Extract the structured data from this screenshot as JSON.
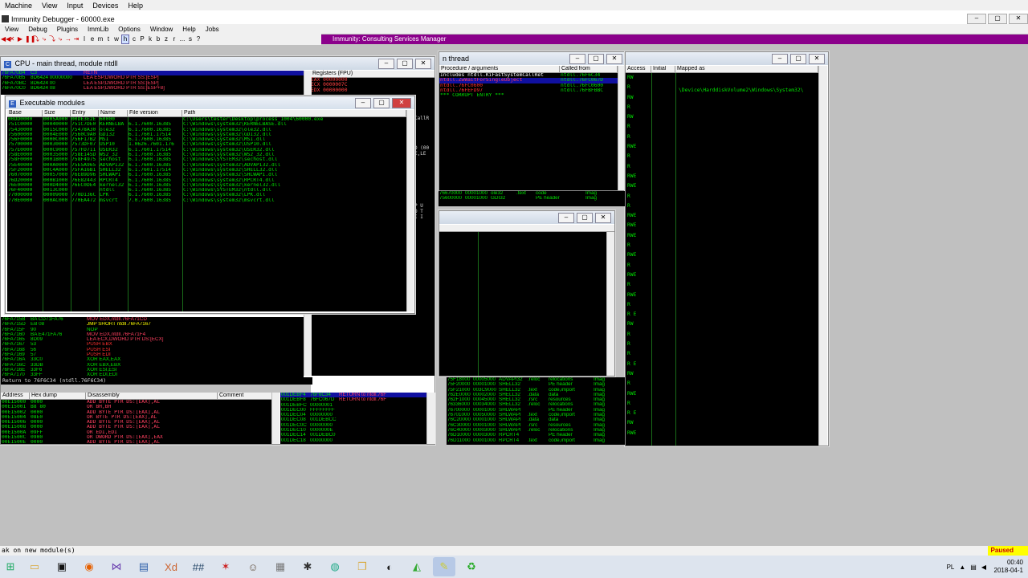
{
  "outer_menu": [
    "Machine",
    "View",
    "Input",
    "Devices",
    "Help"
  ],
  "title": "Immunity Debugger - 60000.exe",
  "app_menu": [
    "View",
    "Debug",
    "Plugins",
    "ImmLib",
    "Options",
    "Window",
    "Help",
    "Jobs"
  ],
  "toolbar_letters": [
    "l",
    "e",
    "m",
    "t",
    "w",
    "h",
    "c",
    "P",
    "k",
    "b",
    "z",
    "r",
    "...",
    "s",
    "?"
  ],
  "banner": "Immunity: Consulting Services Manager",
  "cpu": {
    "title": "CPU - main thread, module ntdll",
    "registers_header": "Registers (FPU)",
    "reg_lines": [
      "EAX 00000000",
      "ECX 0000007C",
      "EDX 00000000"
    ],
    "top_rows": [
      [
        "76FA70B4",
        "C3",
        "RETN"
      ],
      [
        "76FA70B5",
        "8D6424 00000000",
        "LEA ESP,DWORD PTR SS:[ESP]"
      ],
      [
        "76FA70BC",
        "8D6424 00",
        "LEA ESP,DWORD PTR SS:[ESP]"
      ],
      [
        "76FA70C0",
        "8D6424 08",
        "LEA ESP,DWORD PTR SS:[ESP+8]"
      ]
    ],
    "lower_rows": [
      [
        "76FA715B",
        "BA CD71FA76",
        "MOV EDX,ntdll.76FA71CD"
      ],
      [
        "76FA715D",
        "EB 08",
        "JMP SHORT ntdll.76FA7167"
      ],
      [
        "76FA715F",
        "90",
        "NOP"
      ],
      [
        "76FA7160",
        "BA E471FA76",
        "MOV EDX,ntdll.76FA71F4"
      ],
      [
        "76FA7165",
        "8D09",
        "LEA ECX,DWORD PTR DS:[ECX]"
      ],
      [
        "76FA7167",
        "53",
        "PUSH EBX"
      ],
      [
        "76FA7168",
        "56",
        "PUSH ESI"
      ],
      [
        "76FA7169",
        "57",
        "PUSH EDI"
      ],
      [
        "76FA716A",
        "33C0",
        "XOR EAX,EAX"
      ],
      [
        "76FA716C",
        "33DB",
        "XOR EBX,EBX"
      ],
      [
        "76FA716E",
        "33F6",
        "XOR ESI,ESI"
      ],
      [
        "76FA7170",
        "33FF",
        "XOR EDI,EDI"
      ]
    ],
    "return_line": "Return to 76F6C34 (ntdll.76F6C34)",
    "dump_headers": [
      "Address",
      "Hex dump",
      "Disassembly",
      "Comment"
    ],
    "dump_rows": [
      [
        "00E15000",
        "0000",
        "ADD BYTE PTR DS:[EAX],AL"
      ],
      [
        "00E15001",
        "B8 80",
        "OR BH,BH"
      ],
      [
        "00E15002",
        "0000",
        "ADD BYTE PTR DS:[EAX],AL"
      ],
      [
        "00E15004",
        "08E0",
        "OR BYTE PTR DS:[EAX],AL"
      ],
      [
        "00E15006",
        "0000",
        "ADD BYTE PTR DS:[EAX],AL"
      ],
      [
        "00E15008",
        "0000",
        "ADD BYTE PTR DS:[EAX],AL"
      ],
      [
        "00E1500A",
        "09FF",
        "OR EDI,EDI"
      ],
      [
        "00E1500C",
        "0900",
        "OR DWORD PTR DS:[EAX],EAX"
      ],
      [
        "00E1500E",
        "0000",
        "ADD BYTE PTR DS:[EAX],AL"
      ],
      [
        "00E15010",
        "09FF",
        "OR EDI,EDI"
      ]
    ],
    "stack_rows": [
      [
        "001DEBF4",
        "76F6C34",
        "RETURN to ntdll.76F"
      ],
      [
        "001DEBF8",
        "76FC067D",
        "RETURN to ntdll.76F"
      ],
      [
        "001DEBFC",
        "00000001",
        ""
      ],
      [
        "001DEC00",
        "FFFFFFFF",
        ""
      ],
      [
        "001DEC04",
        "00000000",
        ""
      ],
      [
        "001DEC08",
        "001DEBCC",
        ""
      ],
      [
        "001DEC0C",
        "00000000",
        ""
      ],
      [
        "001DEC10",
        "0000000E",
        ""
      ],
      [
        "001DEC14",
        "001DEBC0",
        ""
      ],
      [
        "001DEC18",
        "00000000",
        ""
      ]
    ]
  },
  "modules": {
    "title": "Executable modules",
    "headers": [
      "Base",
      "Size",
      "Entry",
      "Name",
      "File version",
      "Path"
    ],
    "rows": [
      [
        "00DD0000",
        "0005A000",
        "00DE3E2E",
        "60000",
        "",
        "C:\\Users\\tester\\Desktop\\process_1004\\60000.exe"
      ],
      [
        "751C0000",
        "00040000",
        "751C7DE0",
        "KERNELBA",
        "6.1.7600.16385",
        "C:\\Windows\\system32\\KERNELBASE.dll"
      ],
      [
        "75430000",
        "0015C000",
        "75478A30",
        "ole32",
        "6.1.7600.16385",
        "C:\\Windows\\system32\\ole32.dll"
      ],
      [
        "75600000",
        "0004E000",
        "7560C9A0",
        "GDI32",
        "6.1.7601.17514",
        "C:\\Windows\\system32\\GDI32.dll"
      ],
      [
        "756F0000",
        "0000C000",
        "756F17B2",
        "MSI",
        "6.1.7600.16385",
        "C:\\Windows\\system32\\MSI.dll"
      ],
      [
        "75700000",
        "00030000",
        "7573DF07",
        "USP10",
        "1.0626.7601.176",
        "C:\\Windows\\system32\\USP10.dll"
      ],
      [
        "757E0000",
        "000C9000",
        "757FD711",
        "USER32",
        "6.1.7601.17514",
        "C:\\Windows\\system32\\USER32.dll"
      ],
      [
        "758E0000",
        "00035000",
        "758E145D",
        "WS2_32",
        "6.1.7600.16385",
        "C:\\Windows\\system32\\WS2_32.dll"
      ],
      [
        "758F0000",
        "0001B000",
        "758F4975",
        "sechost",
        "6.1.7600.16385",
        "C:\\Windows\\SYSTEM32\\sechost.dll"
      ],
      [
        "75E40000",
        "000A0000",
        "75E5A965",
        "ADVAPI32",
        "6.1.7600.16385",
        "C:\\Windows\\system32\\ADVAPI32.dll"
      ],
      [
        "75F20000",
        "00C4A000",
        "75FA16B1",
        "SHELL32",
        "6.1.7601.17514",
        "C:\\Windows\\system32\\SHELL32.dll"
      ],
      [
        "76070000",
        "00057000",
        "76E89D96",
        "SHLWAPI",
        "6.1.7600.16385",
        "C:\\Windows\\system32\\SHLWAPI.dll"
      ],
      [
        "76D20000",
        "000B1000",
        "76E82443",
        "RPCRT4",
        "6.1.7600.16385",
        "C:\\Windows\\system32\\RPCRT4.dll"
      ],
      [
        "76E00000",
        "000D4000",
        "76EC0DE4",
        "kernel32",
        "6.1.7600.16385",
        "C:\\Windows\\system32\\kernel32.dll"
      ],
      [
        "76F40000",
        "0013C000",
        "",
        "ntdll",
        "6.1.7600.16385",
        "C:\\Windows\\SYSTEM32\\ntdll.dll"
      ],
      [
        "77000000",
        "00009000",
        "770D136C",
        "LPK",
        "6.1.7600.16385",
        "C:\\Windows\\system32\\LPK.dll"
      ],
      [
        "770E0000",
        "000AC000",
        "770EA472",
        "msvcrt",
        "7.0.7600.16385",
        "C:\\Windows\\system32\\msvcrt.dll"
      ]
    ]
  },
  "threads": {
    "title": "n thread",
    "headers": [
      "Procedure / arguments",
      "Called from"
    ],
    "rows": [
      [
        "Includes ntdll.KiFastSystemCallRet",
        "ntdll.76F6C34"
      ],
      [
        "ntdll.ZwWaitForSingleObject",
        "ntdll.76FC067D"
      ],
      [
        "ntdll.76FC0600",
        "ntdll.76FC0600"
      ],
      [
        "ntdll.76FEFD97",
        "ntdll.76FBFBBC"
      ],
      [
        "*** CORRUPT ENTRY ***",
        ""
      ]
    ]
  },
  "memory": {
    "headers": [
      "Access",
      "Initial",
      "Mapped as"
    ],
    "mapped": "\\Device\\HarddiskVolume2\\Windows\\System32\\",
    "mid_rows": [
      [
        "76670000",
        "00001000",
        "ole32",
        ".text",
        "code",
        "Imag"
      ],
      [
        "75600000",
        "00001000",
        "GDI32",
        "",
        "PE header",
        "Imag"
      ]
    ],
    "bottom_rows": [
      [
        "75F18000",
        "00005000",
        "ADVAPI32",
        ".reloc",
        "relocations",
        "Imag"
      ],
      [
        "75F20000",
        "00001000",
        "SHELL32",
        "",
        "PE header",
        "Imag"
      ],
      [
        "75F21000",
        "003C9000",
        "SHELL32",
        ".text",
        "code,import",
        "Imag"
      ],
      [
        "762E0000",
        "00002000",
        "SHELL32",
        ".data",
        "data",
        "Imag"
      ],
      [
        "762F1000",
        "00045000",
        "SHELL32",
        ".rsrc",
        "resources",
        "Imag"
      ],
      [
        "76336000",
        "00034000",
        "SHELL32",
        ".reloc",
        "relocations",
        "Imag"
      ],
      [
        "76700000",
        "00001000",
        "SHLWAPI",
        "",
        "PE header",
        "Imag"
      ],
      [
        "76701000",
        "00050000",
        "SHLWAPI",
        ".text",
        "code,import",
        "Imag"
      ],
      [
        "76C20000",
        "00001000",
        "SHLWAPI",
        ".data",
        "data",
        "Imag"
      ],
      [
        "76C30000",
        "00001000",
        "SHLWAPI",
        ".rsrc",
        "resources",
        "Imag"
      ],
      [
        "76C40000",
        "00003000",
        "SHLWAPI",
        ".reloc",
        "relocations",
        "Imag"
      ],
      [
        "76D10000",
        "00003000",
        "RPCRT4",
        "",
        "PE header",
        "Imag"
      ],
      [
        "76D11000",
        "00001000",
        "RPCRT4",
        ".text",
        "code,import",
        "Imag"
      ]
    ],
    "access_vals": [
      "RW",
      "R",
      "RW",
      "R",
      "RW",
      "R",
      "R",
      "RWE",
      "R",
      "R",
      "RWE",
      "RWE",
      "R",
      "R",
      "RWE",
      "RWE",
      "RWE",
      "R",
      "RWE",
      "R",
      "RWE",
      "R",
      "RWE",
      "R",
      "R E",
      "RW",
      "R",
      "R",
      "R",
      "R E",
      "RW",
      "R",
      "RWE",
      "R",
      "R E",
      "RW",
      "RWE"
    ]
  },
  "status": "ak on new module(s)",
  "paused": "Paused",
  "clock": {
    "time": "00:40",
    "date": "2018-04-1"
  },
  "taskbar_icons": [
    "start-icon",
    "file-manager-icon",
    "terminal-icon",
    "firefox-icon",
    "visual-studio-icon",
    "save-disk-icon",
    "xd-icon",
    "hex-editor-icon",
    "spider-icon",
    "avatar-icon",
    "archive-icon",
    "bug-icon",
    "browser-icon",
    "folder-icon",
    "monkey-icon",
    "plot-icon",
    "notes-icon",
    "recycle-icon"
  ]
}
